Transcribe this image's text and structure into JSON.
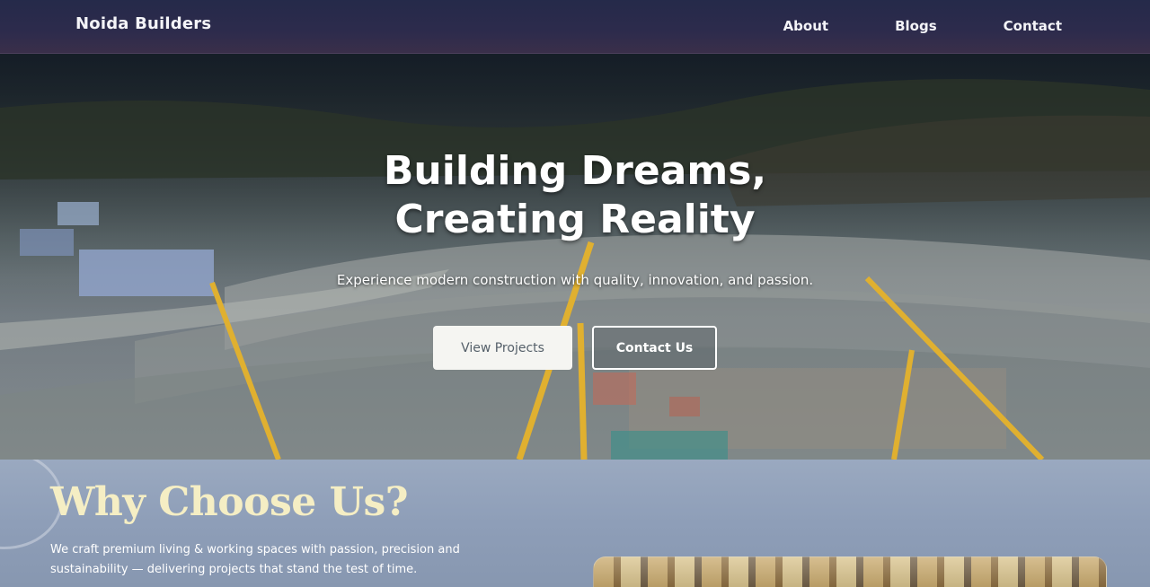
{
  "nav": {
    "brand": "Noida Builders",
    "links": [
      "About",
      "Blogs",
      "Contact"
    ]
  },
  "hero": {
    "title_line1": "Building Dreams,",
    "title_line2": "Creating Reality",
    "subtitle": "Experience modern construction with quality, innovation, and passion.",
    "primary_button": "View Projects",
    "secondary_button": "Contact Us"
  },
  "why": {
    "title": "Why Choose Us?",
    "text_line1": "We craft premium living & working spaces with passion, precision and",
    "text_line2": "sustainability — delivering projects that stand the test of time."
  },
  "colors": {
    "nav_bg": "#2d2b4c",
    "why_bg": "#8e9eb8",
    "why_title": "#f5eec4",
    "crane": "#e0b030"
  }
}
